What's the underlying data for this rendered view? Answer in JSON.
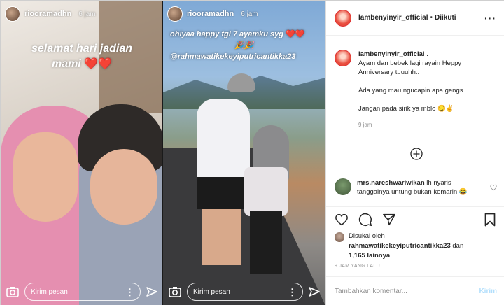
{
  "story_left": {
    "username": "riooramadhn",
    "time": "6 jam",
    "caption_line1": "selamat hari jadian",
    "caption_line2": "mami",
    "hearts": "❤️❤️",
    "reply_placeholder": "Kirim pesan"
  },
  "story_right": {
    "username": "riooramadhn",
    "time": "6 jam",
    "caption_line1": "ohiyaa happy tgl 7 ayamku syg",
    "caption_hearts": "❤️❤️",
    "caption_emoji": "🎉🎉",
    "mention": "@rahmawatikekeyiputricantikka23",
    "reply_placeholder": "Kirim pesan"
  },
  "post": {
    "username": "lambenyinyir_official",
    "separator": "•",
    "follow_state": "Diikuti",
    "caption_username": "lambenyinyir_official",
    "caption_first": ".",
    "caption_lines": [
      "Ayam dan bebek lagi rayain Heppy",
      "Anniversary tuuuhh..",
      ".",
      "Ada yang mau ngucapin apa gengs....",
      ".",
      "Jangan pada sirik ya mblo 😏✌️"
    ],
    "caption_time": "9 jam",
    "comment": {
      "username": "mrs.nareshwariwikan",
      "text": "lh nyaris tanggalnya untung bukan kemarin 😂"
    },
    "likes_prefix": "Disukai oleh",
    "likes_user": "rahmawatikekeyiputricantikka23",
    "likes_and": "dan",
    "likes_others": "1,165 lainnya",
    "date": "9 JAM YANG LALU",
    "comment_placeholder": "Tambahkan komentar...",
    "post_button": "Kirim"
  },
  "icons": [
    "camera-icon",
    "send-icon",
    "more-icon",
    "heart-icon",
    "comment-icon",
    "share-icon",
    "bookmark-icon",
    "plus-circle-icon"
  ],
  "colors": {
    "heart_red": "#e0245e",
    "post_disabled": "#b2dffc",
    "muted": "#8e8e8e"
  }
}
